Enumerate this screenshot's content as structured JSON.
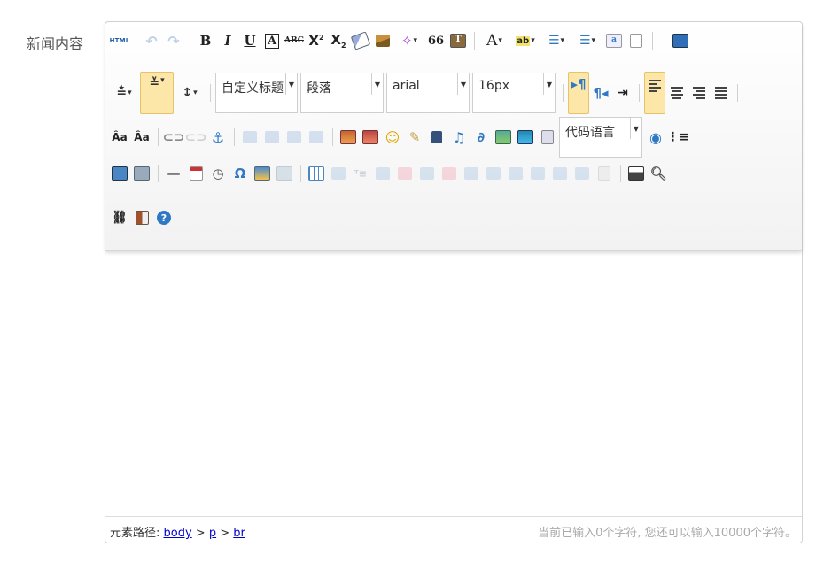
{
  "form": {
    "label": "新闻内容"
  },
  "toolbar": {
    "font_style": "自定义标题",
    "paragraph": "段落",
    "font_family": "arial",
    "font_size": "16px",
    "code_language": "代码语言",
    "html_label": "HTML",
    "bold": "B",
    "italic": "I",
    "underline": "U",
    "fontborder": "A",
    "strike": "ABC",
    "superscript": "X",
    "superscript_mark": "2",
    "subscript": "X",
    "subscript_mark": "2",
    "quote": "66",
    "forecolor": "A",
    "backcolor": "ab",
    "special_char": "Ω"
  },
  "statusbar": {
    "path_label": "元素路径: ",
    "path": [
      "body",
      "p",
      "br"
    ],
    "path_sep": " > ",
    "counter": "当前已输入0个字符, 您还可以输入10000个字符。"
  },
  "colors": {
    "active_bg": "#fde7a8",
    "link": "#0000cc",
    "accent_blue": "#2f78c4"
  }
}
